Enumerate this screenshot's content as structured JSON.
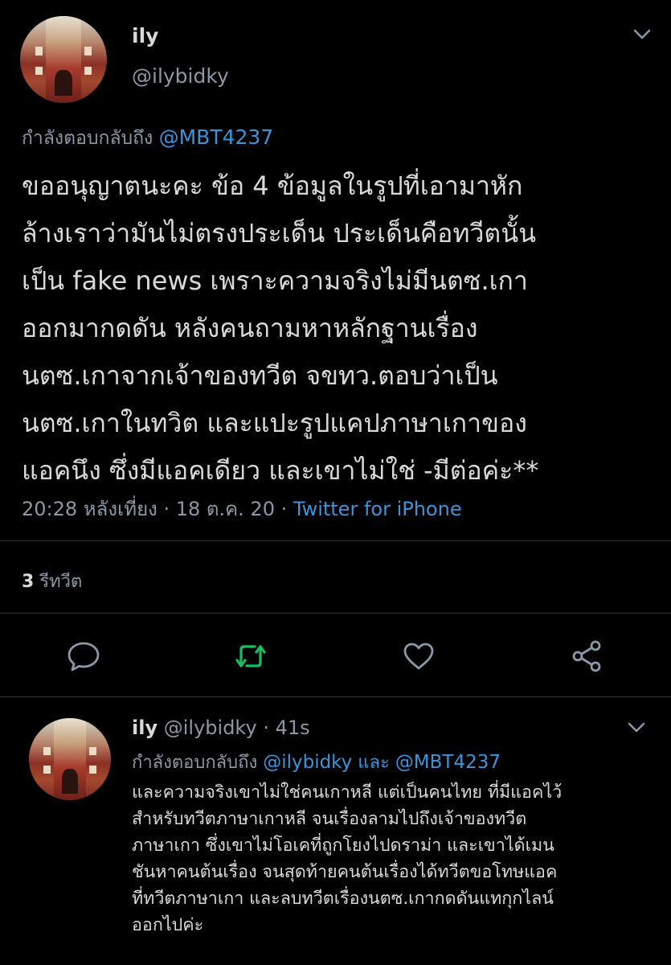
{
  "main_tweet": {
    "name": "ily",
    "handle": "@ilybidky",
    "replying_to_prefix": "กำลังตอบกลับถึง",
    "replying_to": "@MBT4237",
    "text": "ขออนุญาตนะคะ ข้อ 4 ข้อมูลในรูปที่เอามาหัก\nล้างเราว่ามันไม่ตรงประเด็น ประเด็นคือทวีตนั้น\nเป็น fake news เพราะความจริงไม่มีนตซ.เกา\nออกมากดดัน หลังคนถามหาหลักฐานเรื่อง\nนตซ.เกาจากเจ้าของทวีต จขทว.ตอบว่าเป็น\nนตซ.เกาในทวิต และแปะรูปแคปภาษาเกาของ\nแอคนึง ซึ่งมีแอคเดียว และเขาไม่ใช่ -มีต่อค่ะ**",
    "timestamp": "20:28 หลังเที่ยง · 18 ต.ค. 20 ·",
    "source": "Twitter for iPhone",
    "retweet_count": "3",
    "retweet_label": "รีทวีต"
  },
  "actions": {
    "reply_icon": "reply-icon",
    "retweet_icon": "retweet-icon",
    "like_icon": "heart-icon",
    "share_icon": "share-icon",
    "retweet_color": "#17bf63"
  },
  "reply_tweet": {
    "name": "ily",
    "handle": "@ilybidky",
    "time": "· 41s",
    "replying_to_prefix": "กำลังตอบกลับถึง",
    "replying_to_1": "@ilybidky",
    "replying_and": "และ",
    "replying_to_2": "@MBT4237",
    "text": "และความจริงเขาไม่ใช่คนเกาหลี แต่เป็นคนไทย ที่มีแอคไว้\nสำหรับทวีตภาษาเกาหลี จนเรื่องลามไปถึงเจ้าของทวีต\nภาษาเกา ซึ่งเขาไม่โอเคที่ถูกโยงไปดราม่า และเขาได้เมน\nชันหาคนต้นเรื่อง จนสุดท้ายคนต้นเรื่องได้ทวีตขอโทษแอค\nที่ทวีตภาษาเกา และลบทวีตเรื่องนตซ.เกากดดันแทกุกไลน์\nออกไปค่ะ"
  },
  "colors": {
    "background": "#000000",
    "text": "#d9d9d9",
    "muted": "#8b98a5",
    "link": "#3b94d9"
  }
}
